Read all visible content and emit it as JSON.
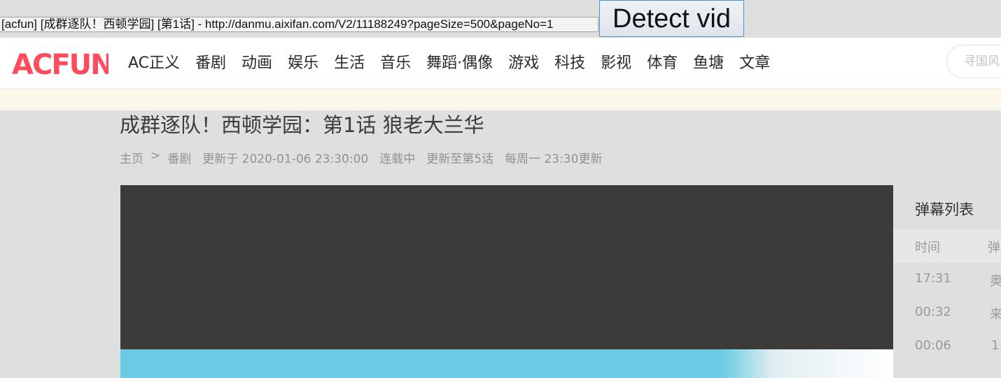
{
  "injected_bar": {
    "url_value": "[acfun] [成群逐队！西顿学园] [第1话] - http://danmu.aixifan.com/V2/11188249?pageSize=500&pageNo=1",
    "detect_button": "Detect vid"
  },
  "nav": {
    "logo_text": "ACFUN",
    "items": [
      "AC正义",
      "番剧",
      "动画",
      "娱乐",
      "生活",
      "音乐",
      "舞蹈·偶像",
      "游戏",
      "科技",
      "影视",
      "体育",
      "鱼塘",
      "文章"
    ],
    "search_placeholder": "寻国风"
  },
  "video": {
    "title": "成群逐队！西顿学园：第1话  狼老大兰华",
    "breadcrumb": [
      "主页",
      "番剧"
    ],
    "breadcrumb_sep": ">",
    "updated": "更新于 2020-01-06  23:30:00",
    "status": "连载中",
    "progress": "更新至第5话",
    "schedule": "每周一  23:30更新"
  },
  "danmu": {
    "title": "弹幕列表",
    "col_time": "时间",
    "col_content": "弹",
    "rows": [
      {
        "time": "17:31",
        "content": "奥"
      },
      {
        "time": "00:32",
        "content": "来"
      },
      {
        "time": "00:06",
        "content": "1"
      }
    ]
  },
  "colors": {
    "logo": "#fd4c5d",
    "player_dark": "#3c3b3a",
    "sky": "#6ccbe4"
  }
}
